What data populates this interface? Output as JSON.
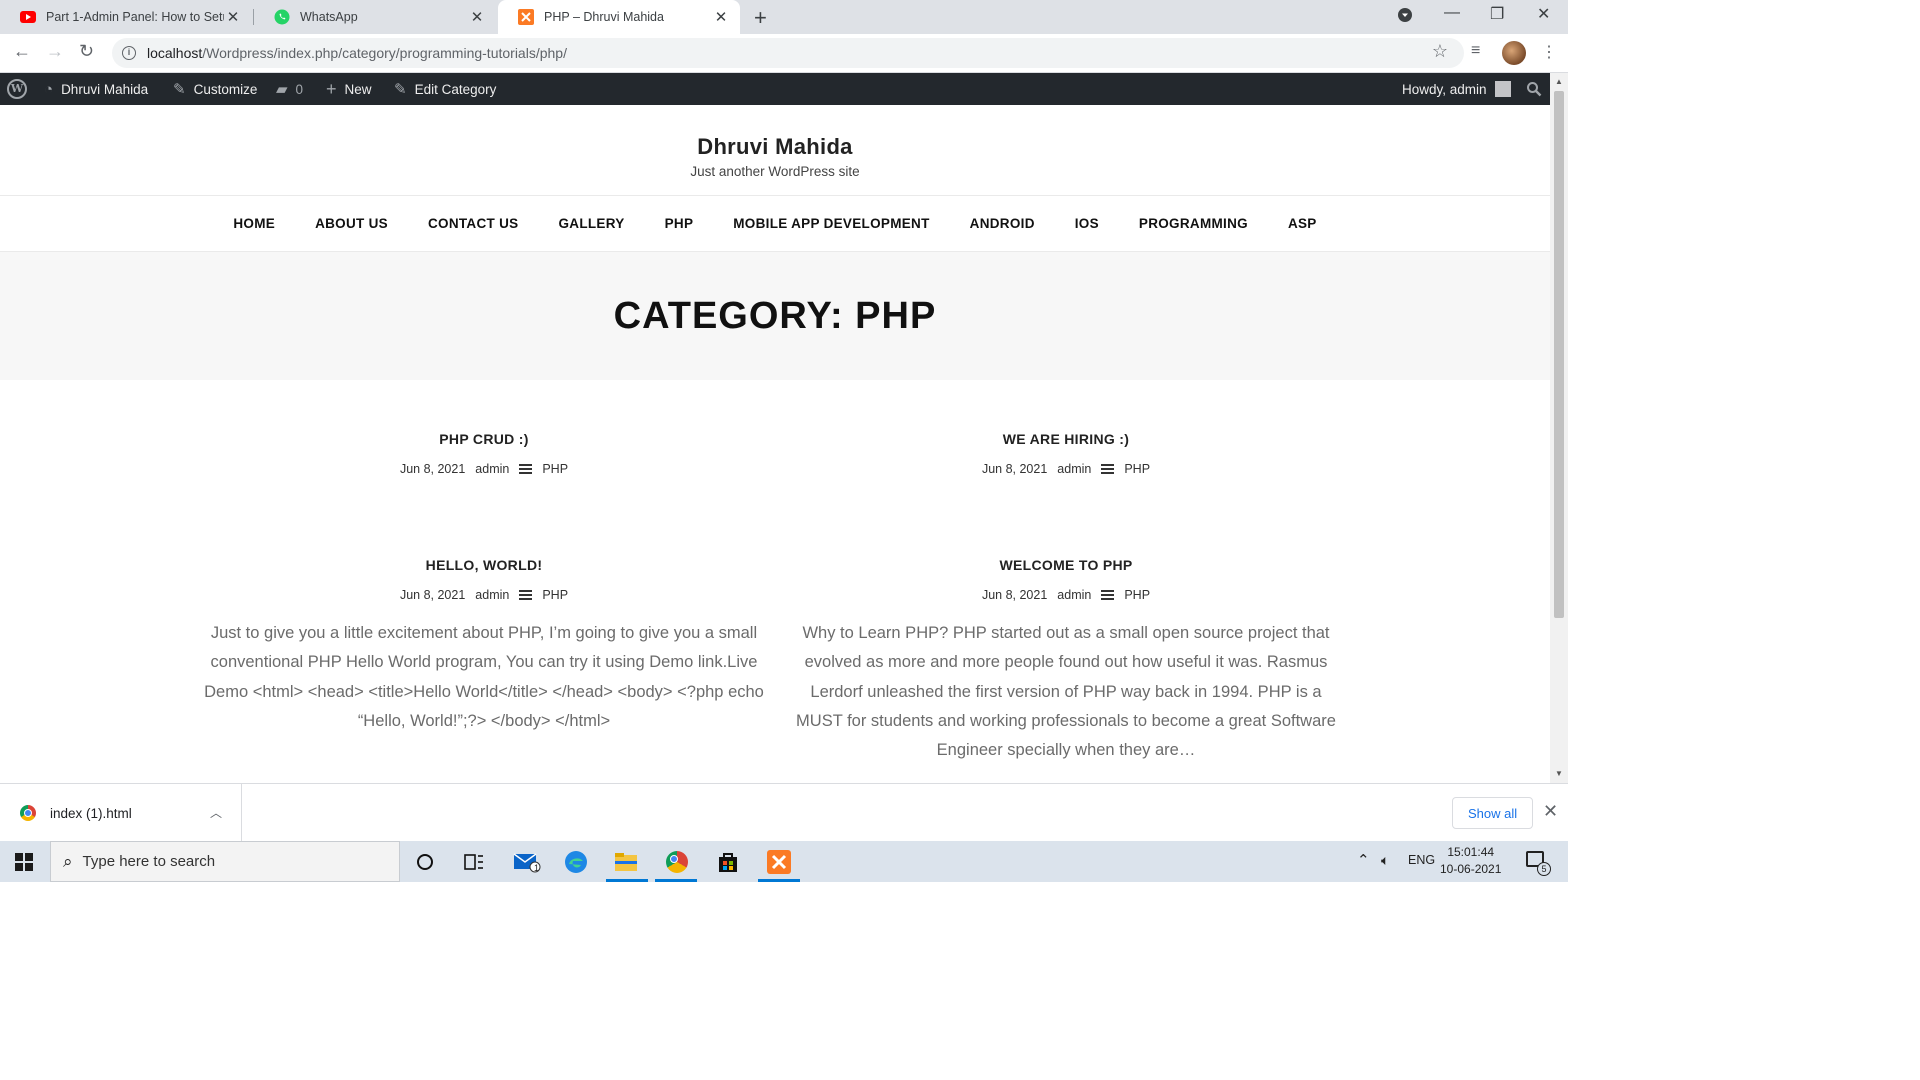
{
  "browser": {
    "tabs": [
      {
        "title": "Part 1-Admin Panel: How to Setu",
        "icon": "youtube-icon",
        "active": false
      },
      {
        "title": "WhatsApp",
        "icon": "whatsapp-icon",
        "active": false
      },
      {
        "title": "PHP – Dhruvi Mahida",
        "icon": "xampp-icon",
        "active": true
      }
    ],
    "new_tab_glyph": "+",
    "url_host": "localhost",
    "url_path": "/Wordpress/index.php/category/programming-tutorials/php/"
  },
  "adminbar": {
    "site_name": "Dhruvi Mahida",
    "customize": "Customize",
    "comments_count": "0",
    "new_label": "New",
    "edit_label": "Edit Category",
    "howdy": "Howdy, admin"
  },
  "site": {
    "title": "Dhruvi Mahida",
    "tagline": "Just another WordPress site"
  },
  "nav": {
    "items": [
      "HOME",
      "ABOUT US",
      "CONTACT US",
      "GALLERY",
      "PHP",
      "MOBILE APP DEVELOPMENT",
      "ANDROID",
      "IOS",
      "PROGRAMMING",
      "ASP"
    ]
  },
  "page": {
    "heading": "CATEGORY: PHP"
  },
  "posts": [
    {
      "title": "PHP CRUD :)",
      "date": "Jun 8, 2021",
      "author": "admin",
      "category": "PHP",
      "excerpt": ""
    },
    {
      "title": "WE ARE HIRING :)",
      "date": "Jun 8, 2021",
      "author": "admin",
      "category": "PHP",
      "excerpt": ""
    },
    {
      "title": "HELLO, WORLD!",
      "date": "Jun 8, 2021",
      "author": "admin",
      "category": "PHP",
      "excerpt": "Just to give you a little excitement about PHP, I’m going to give you a small conventional PHP Hello World program, You can try it using Demo link.Live Demo <html> <head> <title>Hello World</title> </head> <body> <?php echo “Hello, World!”;?> </body> </html>"
    },
    {
      "title": "WELCOME TO PHP",
      "date": "Jun 8, 2021",
      "author": "admin",
      "category": "PHP",
      "excerpt": "Why to Learn PHP? PHP started out as a small open source project that evolved as more and more people found out how useful it was. Rasmus Lerdorf unleashed the first version of PHP way back in 1994. PHP is a MUST for students and working professionals to become a great Software Engineer specially when they are…"
    }
  ],
  "download": {
    "filename": "index (1).html",
    "show_all": "Show all"
  },
  "taskbar": {
    "search_placeholder": "Type here to search",
    "mail_badge": "1",
    "language": "ENG",
    "time": "15:01:44",
    "date": "10-06-2021",
    "notification_count": "5"
  }
}
